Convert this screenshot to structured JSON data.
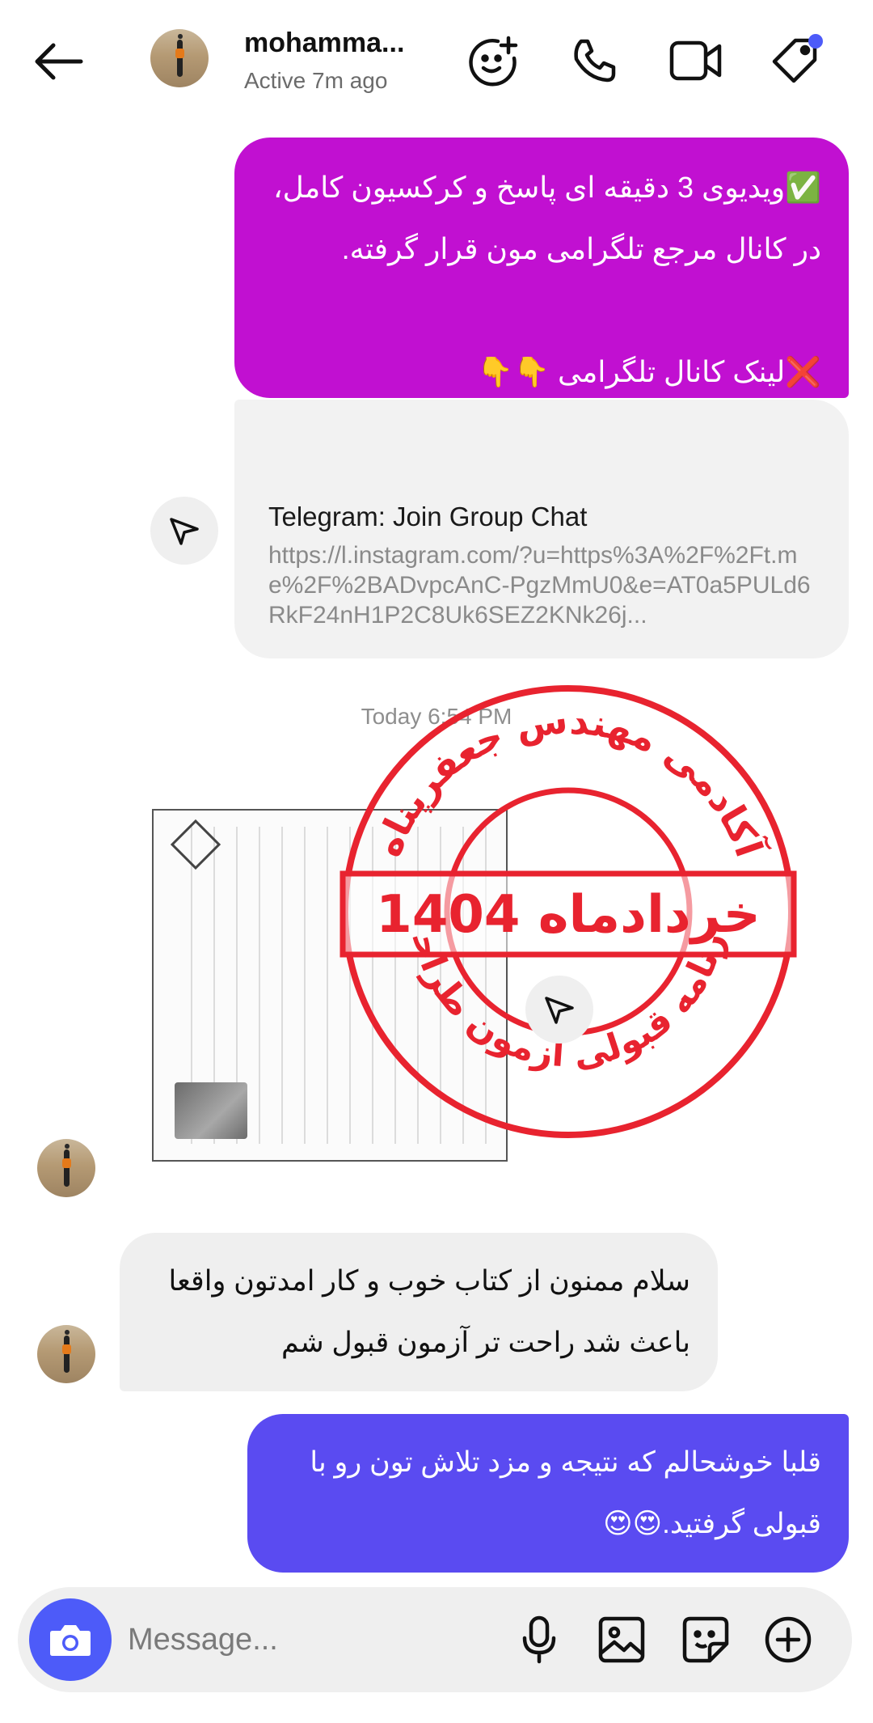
{
  "header": {
    "contact_name": "mohamma...",
    "status": "Active 7m ago",
    "icons": [
      "back-arrow-icon",
      "game-controller-add-icon",
      "phone-icon",
      "video-camera-icon",
      "tag-icon"
    ],
    "accent_dot_color": "#4d5bf9"
  },
  "messages": [
    {
      "direction": "outgoing",
      "color": "#c110d1",
      "lines": [
        "✅ویدیوی 3 دقیقه ای پاسخ و کرکسیون کامل،",
        "در کانال مرجع تلگرامی مون قرار گرفته.",
        "",
        "❌لینک کانال تلگرامی 👇👇"
      ]
    },
    {
      "direction": "outgoing",
      "type": "link_preview",
      "title": "Telegram: Join Group Chat",
      "url": "https://l.instagram.com/?u=https%3A%2F%2Ft.me%2F%2BADvpcAnC-PgzMmU0&e=AT0a5PULd6RkF24nH1P2C8Uk6SEZ2KNk26j..."
    },
    {
      "type": "timestamp",
      "text": "Today 6:54 PM"
    },
    {
      "direction": "incoming",
      "type": "image",
      "stamp_top": "آکادمی مهندس جعفرپناه",
      "stamp_middle": "خردادماه 1404",
      "stamp_bottom": "کارنامه قبولی آزمون طراحی",
      "stamp_color": "#e8232f"
    },
    {
      "direction": "incoming",
      "color": "#efefef",
      "lines": [
        "سلام ممنون از کتاب خوب و کار امدتون واقعا",
        "باعث شد راحت تر آزمون قبول شم"
      ]
    },
    {
      "direction": "outgoing",
      "color": "#5a4bf1",
      "lines": [
        "قلبا خوشحالم که نتیجه و مزد تلاش تون رو با",
        "قبولی گرفتید.😍😍"
      ]
    }
  ],
  "composer": {
    "placeholder": "Message...",
    "icons": [
      "camera-icon",
      "microphone-icon",
      "gallery-icon",
      "sticker-icon",
      "add-icon"
    ]
  }
}
